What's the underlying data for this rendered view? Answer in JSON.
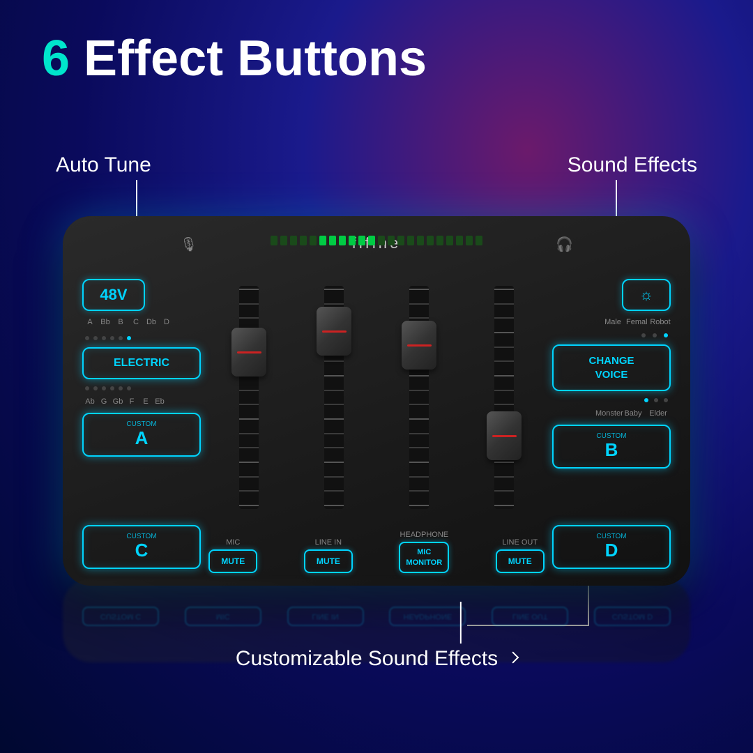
{
  "page": {
    "title_number": "6",
    "title_text": " Effect Buttons"
  },
  "labels": {
    "auto_tune": "Auto Tune",
    "sound_effects": "Sound Effects",
    "customizable": "Customizable Sound Effects"
  },
  "device": {
    "brand": "fifine",
    "buttons": {
      "power_48v": "48V",
      "electric": "ELECTRIC",
      "custom_a_label": "CUSTOM",
      "custom_a_letter": "A",
      "custom_c_label": "CUSTOM",
      "custom_c_letter": "C",
      "brightness": "☼",
      "change_voice": "CHANGE\nVOICE",
      "custom_b_label": "CUSTOM",
      "custom_b_letter": "B",
      "custom_d_label": "CUSTOM",
      "custom_d_letter": "D"
    },
    "note_labels_top": [
      "A",
      "Bb",
      "B",
      "C",
      "Db",
      "D"
    ],
    "note_labels_bottom": [
      "Ab",
      "G",
      "Gb",
      "F",
      "E",
      "Eb"
    ],
    "voice_labels_top": [
      "Male",
      "Femal",
      "Robot"
    ],
    "voice_labels_bottom": [
      "Monster",
      "Baby",
      "Elder"
    ],
    "channels": [
      {
        "label": "MIC",
        "button": "MUTE"
      },
      {
        "label": "LINE IN",
        "button": "MUTE"
      },
      {
        "label": "HEADPHONE",
        "button": "MIC\nMONITOR"
      },
      {
        "label": "LINE OUT",
        "button": "MUTE"
      }
    ],
    "faders": [
      {
        "position": "pos1"
      },
      {
        "position": "pos2"
      },
      {
        "position": "pos3"
      },
      {
        "position": "pos4"
      }
    ],
    "meter_segments": 22
  },
  "colors": {
    "accent": "#00d4ff",
    "background_dark": "#000830",
    "device_bg": "#1a1a1a",
    "text_white": "#ffffff",
    "title_cyan": "#00e5cc"
  }
}
